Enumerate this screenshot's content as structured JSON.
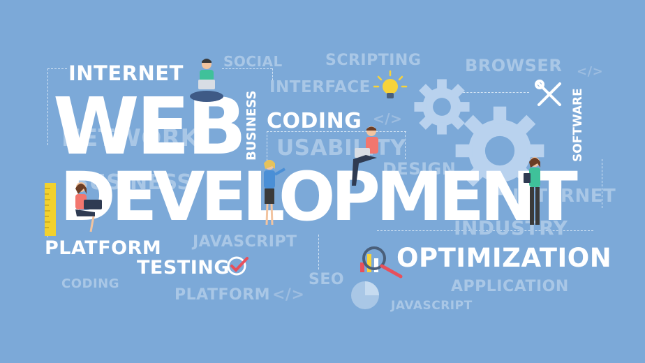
{
  "title": {
    "line1": "WEB",
    "line2": "DEVELOPMENT"
  },
  "keywords": {
    "internet": "INTERNET",
    "social": "SOCIAL",
    "scripting": "SCRIPTING",
    "browser": "BROWSER",
    "interface": "INTERFACE",
    "business": "BUSINESS",
    "coding": "CODING",
    "usability": "USABILITY",
    "software": "SOFTWARE",
    "design": "DESIGN",
    "network": "NETWORK",
    "business_faint": "BUSINESS",
    "internet_faint": "INTERNET",
    "industry": "INDUSTRY",
    "platform": "PLATFORM",
    "javascript": "JAVASCRIPT",
    "testing": "TESTING",
    "optimization": "OPTIMIZATION",
    "coding_faint": "CODING",
    "platform_faint": "PLATFORM",
    "seo": "SEO",
    "application": "APPLICATION",
    "javascript_bottom": "JAVASCRIPT",
    "code_tag": "</>"
  },
  "colors": {
    "background": "#7ca9d8",
    "text_primary": "#ffffff",
    "text_faint": "#a9c7e6",
    "bulb": "#f7d33a",
    "check": "#e8505b",
    "ruler": "#f2d12e",
    "gear": "#b9d2ee"
  },
  "icons": [
    "bulb-icon",
    "gear-icon",
    "wrench-icon",
    "magnifier-chart-icon",
    "checkmark-icon",
    "pie-chart-icon",
    "ruler-icon",
    "code-tag-icon"
  ]
}
